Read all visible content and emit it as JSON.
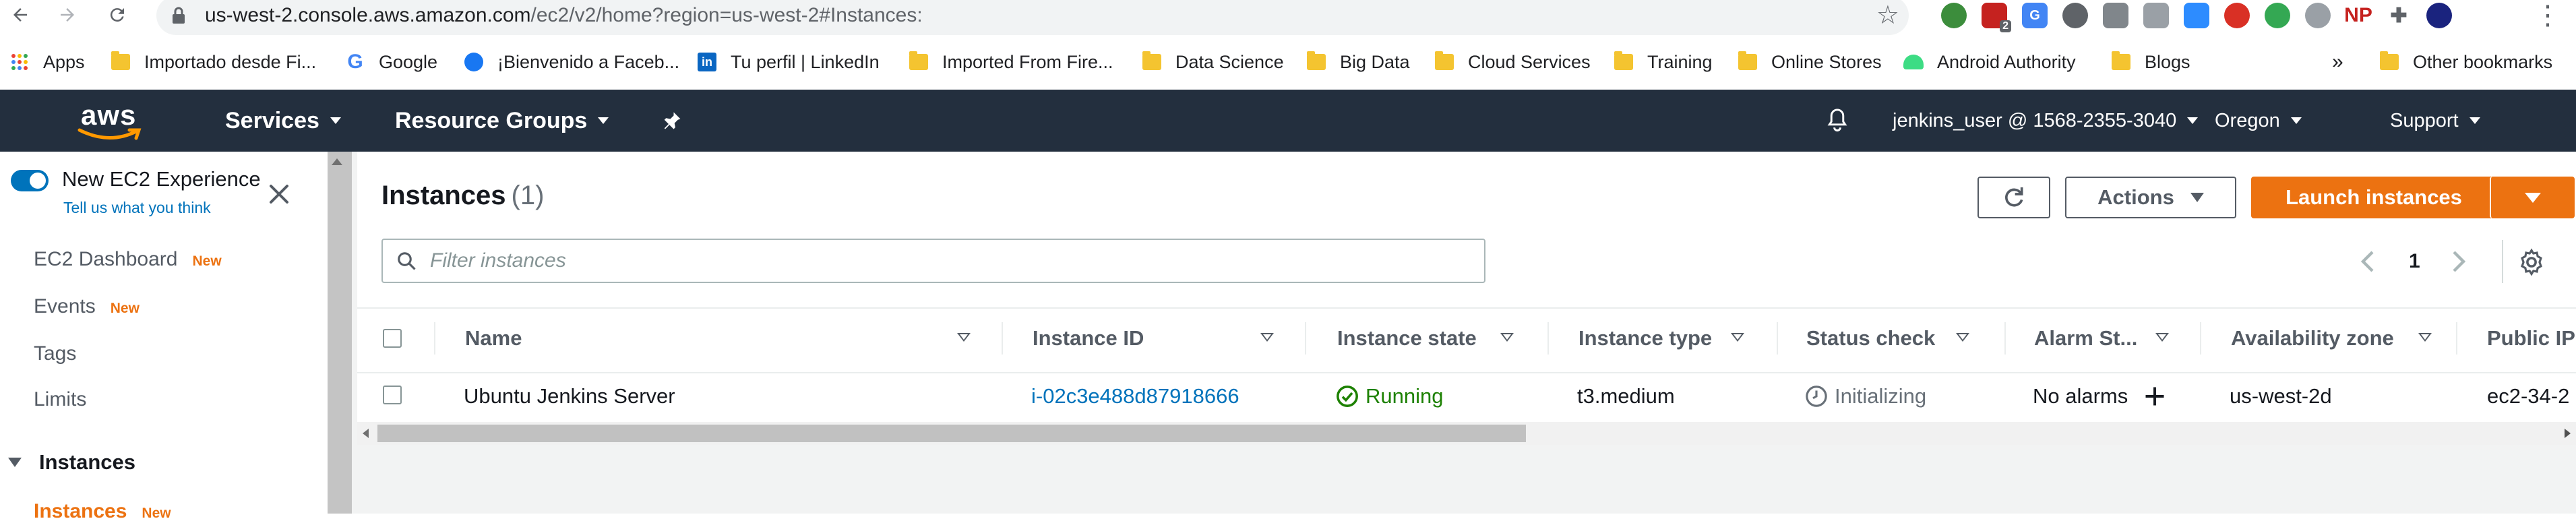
{
  "browser": {
    "url_host": "us-west-2.console.aws.amazon.com",
    "url_rest": "/ec2/v2/home?region=us-west-2#Instances:",
    "extension_badge": "2",
    "extension_np": "NP"
  },
  "bookmarks": {
    "items": [
      {
        "label": "Apps",
        "icon": "apps-grid-icon"
      },
      {
        "label": "Importado desde Fi...",
        "icon": "folder-icon"
      },
      {
        "label": "Google",
        "icon": "google-icon"
      },
      {
        "label": "¡Bienvenido a Faceb...",
        "icon": "facebook-icon"
      },
      {
        "label": "Tu perfil | LinkedIn",
        "icon": "linkedin-icon"
      },
      {
        "label": "Imported From Fire...",
        "icon": "folder-icon"
      },
      {
        "label": "Data Science",
        "icon": "folder-icon"
      },
      {
        "label": "Big Data",
        "icon": "folder-icon"
      },
      {
        "label": "Cloud Services",
        "icon": "folder-icon"
      },
      {
        "label": "Training",
        "icon": "folder-icon"
      },
      {
        "label": "Online Stores",
        "icon": "folder-icon"
      },
      {
        "label": "Android Authority",
        "icon": "android-icon"
      },
      {
        "label": "Blogs",
        "icon": "folder-icon"
      }
    ],
    "overflow": "»",
    "other": "Other bookmarks"
  },
  "aws_header": {
    "logo": "aws",
    "services": "Services",
    "resource_groups": "Resource Groups",
    "account": "jenkins_user @ 1568-2355-3040",
    "region": "Oregon",
    "support": "Support"
  },
  "sidebar": {
    "new_experience": "New EC2 Experience",
    "tell_us": "Tell us what you think",
    "links": [
      {
        "label": "EC2 Dashboard",
        "badge": "New"
      },
      {
        "label": "Events",
        "badge": "New"
      },
      {
        "label": "Tags",
        "badge": ""
      },
      {
        "label": "Limits",
        "badge": ""
      }
    ],
    "section": "Instances",
    "active_item": "Instances",
    "active_badge": "New"
  },
  "main": {
    "title": "Instances",
    "count": "(1)",
    "actions_label": "Actions",
    "launch_label": "Launch instances",
    "search_placeholder": "Filter instances",
    "page_number": "1"
  },
  "table": {
    "columns": [
      "Name",
      "Instance ID",
      "Instance state",
      "Instance type",
      "Status check",
      "Alarm St...",
      "Availability zone",
      "Public IP"
    ],
    "rows": [
      {
        "name": "Ubuntu Jenkins Server",
        "instance_id": "i-02c3e488d87918666",
        "state": "Running",
        "type": "t3.medium",
        "status_check": "Initializing",
        "alarm": "No alarms",
        "az": "us-west-2d",
        "public_ip": "ec2-34-2"
      }
    ]
  },
  "colors": {
    "aws_nav": "#232f3e",
    "accent_orange": "#ec7211",
    "link_blue": "#0073bb",
    "running_green": "#1d8102"
  }
}
